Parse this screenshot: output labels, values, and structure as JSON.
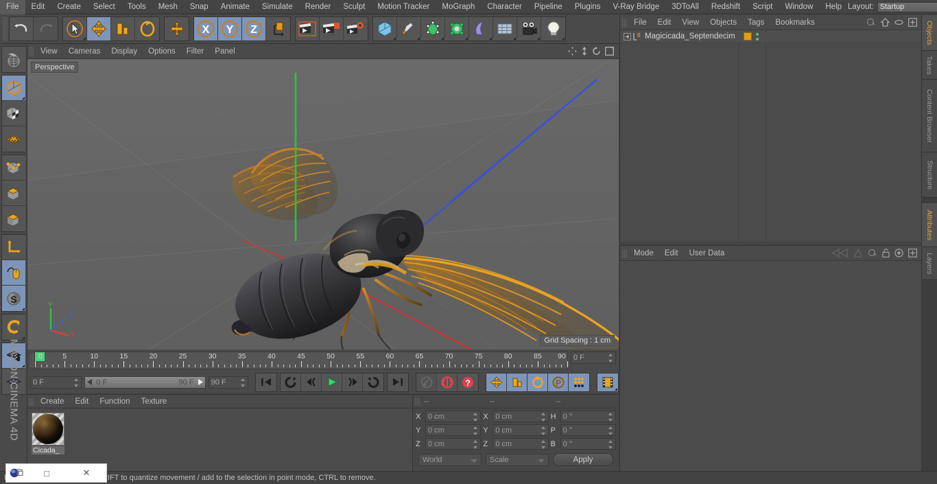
{
  "menubar": {
    "items": [
      "File",
      "Edit",
      "Create",
      "Select",
      "Tools",
      "Mesh",
      "Snap",
      "Animate",
      "Simulate",
      "Render",
      "Sculpt",
      "Motion Tracker",
      "MoGraph",
      "Character",
      "Pipeline",
      "Plugins",
      "V-Ray Bridge",
      "3DToAll",
      "Redshift",
      "Script",
      "Window",
      "Help"
    ],
    "layout_label": "Layout:",
    "layout_value": "Startup"
  },
  "toolbar": {
    "groups": [
      {
        "name": "history",
        "buttons": [
          {
            "name": "undo-button",
            "icon": "undo-icon",
            "state": "normal"
          },
          {
            "name": "redo-button",
            "icon": "redo-icon",
            "state": "disabled"
          }
        ]
      },
      {
        "name": "transform",
        "buttons": [
          {
            "name": "select-tool-button",
            "icon": "cursor-icon",
            "state": "normal"
          },
          {
            "name": "move-tool-button",
            "icon": "move-icon",
            "state": "active"
          },
          {
            "name": "scale-tool-button",
            "icon": "scale-icon",
            "state": "normal"
          },
          {
            "name": "rotate-tool-button",
            "icon": "rotate-icon",
            "state": "normal"
          }
        ]
      },
      {
        "name": "world-axis",
        "buttons": [
          {
            "name": "world-axis-button",
            "icon": "axis-icon",
            "state": "normal"
          }
        ]
      },
      {
        "name": "axis-locks",
        "buttons": [
          {
            "name": "lock-x-button",
            "icon": "x-axis-icon",
            "state": "active"
          },
          {
            "name": "lock-y-button",
            "icon": "y-axis-icon",
            "state": "active"
          },
          {
            "name": "lock-z-button",
            "icon": "z-axis-icon",
            "state": "active"
          },
          {
            "name": "world-coordinate-button",
            "icon": "cube-world-icon",
            "state": "normal"
          }
        ]
      },
      {
        "name": "render",
        "buttons": [
          {
            "name": "render-view-button",
            "icon": "clapper-view-icon",
            "state": "normal"
          },
          {
            "name": "render-to-picture-viewer-button",
            "icon": "clapper-picture-icon",
            "state": "normal"
          },
          {
            "name": "render-settings-button",
            "icon": "clapper-settings-icon",
            "state": "normal"
          }
        ]
      },
      {
        "name": "creation",
        "buttons": [
          {
            "name": "add-cube-button",
            "icon": "cube-icon",
            "state": "normal"
          },
          {
            "name": "add-spline-button",
            "icon": "pen-icon",
            "state": "normal"
          },
          {
            "name": "add-generator-button",
            "icon": "generator-icon",
            "state": "normal"
          },
          {
            "name": "add-deformer-button",
            "icon": "deformer-icon",
            "state": "normal"
          },
          {
            "name": "add-scene-object-button",
            "icon": "environment-icon",
            "state": "normal"
          },
          {
            "name": "add-scene-helper-button",
            "icon": "floor-grid-icon",
            "state": "normal"
          },
          {
            "name": "add-camera-button",
            "icon": "camera-icon",
            "state": "normal"
          },
          {
            "name": "add-light-button",
            "icon": "light-bulb-icon",
            "state": "normal"
          }
        ]
      }
    ]
  },
  "left_toolbar": {
    "buttons": [
      {
        "name": "texture-axis-button",
        "icon": "globe-texture-icon",
        "state": "normal"
      },
      {
        "name": "model-mode-button",
        "icon": "model-cube-icon",
        "state": "active"
      },
      {
        "name": "texture-mode-button",
        "icon": "texture-checker-icon",
        "state": "normal"
      },
      {
        "name": "points-mode-button",
        "icon": "points-grid-icon",
        "state": "normal"
      },
      {
        "name": "edges-mode-button",
        "icon": "edges-cube-icon",
        "state": "normal"
      },
      {
        "name": "polygons-mode-button",
        "icon": "polygon-cube-icon",
        "state": "normal"
      },
      {
        "name": "object-axis-mode-button",
        "icon": "axis-cube-icon",
        "state": "normal"
      },
      {
        "name": "world-object-axis-button",
        "icon": "axis-arrow-icon",
        "state": "normal"
      },
      {
        "name": "enable-axis-button",
        "icon": "mouse-axis-icon",
        "state": "active"
      },
      {
        "name": "soft-selection-button",
        "icon": "s-circle-icon",
        "state": "active"
      },
      {
        "name": "magnet-button",
        "icon": "magnet-icon",
        "state": "normal"
      },
      {
        "name": "viewport-solo-button",
        "icon": "grid-lock-icon",
        "state": "active"
      },
      {
        "name": "workplane-button",
        "icon": "workplane-icon",
        "state": "normal"
      }
    ],
    "brand_line1": "MAXON",
    "brand_line2": "CINEMA 4D"
  },
  "viewport": {
    "menu": [
      "View",
      "Cameras",
      "Display",
      "Options",
      "Filter",
      "Panel"
    ],
    "view_label": "Perspective",
    "grid_spacing": "Grid Spacing : 1 cm",
    "axis": {
      "x": "X",
      "y": "Y",
      "z": "Z",
      "x_color": "#e04040",
      "y_color": "#3ecf52",
      "z_color": "#4060e0"
    },
    "background_color": "#646464",
    "model_name": "Magicicada_Septendecim"
  },
  "timeline": {
    "ticks": [
      0,
      5,
      10,
      15,
      20,
      25,
      30,
      35,
      40,
      45,
      50,
      55,
      60,
      65,
      70,
      75,
      80,
      85,
      90
    ],
    "current_frame_top": "0 F",
    "start_field": "0 F",
    "range_start": "0 F",
    "range_end": "90 F",
    "end_field": "90 F",
    "playback_buttons": [
      {
        "name": "go-to-start-button",
        "icon": "skip-start-icon"
      },
      {
        "name": "previous-keyframe-button",
        "icon": "prev-key-icon"
      },
      {
        "name": "step-back-button",
        "icon": "step-back-icon"
      },
      {
        "name": "play-button",
        "icon": "play-icon"
      },
      {
        "name": "step-forward-button",
        "icon": "step-forward-icon"
      },
      {
        "name": "next-keyframe-button",
        "icon": "next-key-icon"
      },
      {
        "name": "go-to-end-button",
        "icon": "skip-end-icon"
      }
    ],
    "record_buttons": [
      {
        "name": "record-active-objects-button",
        "icon": "key-icon",
        "state": "disabled"
      },
      {
        "name": "autokeying-button",
        "icon": "autokey-icon",
        "state": "normal"
      },
      {
        "name": "keyframe-selection-button",
        "icon": "question-key-icon",
        "state": "normal"
      }
    ],
    "key_toggle_buttons": [
      {
        "name": "position-key-button",
        "icon": "move-key-icon",
        "state": "active"
      },
      {
        "name": "scale-key-button",
        "icon": "scale-key-icon",
        "state": "active"
      },
      {
        "name": "rotation-key-button",
        "icon": "rotate-key-icon",
        "state": "active"
      },
      {
        "name": "parameter-key-button",
        "icon": "param-p-icon",
        "state": "active"
      },
      {
        "name": "point-level-animation-button",
        "icon": "pla-dots-icon",
        "state": "active"
      }
    ],
    "timeline_mode_button": {
      "name": "timeline-mode-button",
      "icon": "film-strip-icon",
      "state": "active"
    }
  },
  "material_manager": {
    "menu": [
      "Create",
      "Edit",
      "Function",
      "Texture"
    ],
    "materials": [
      {
        "name": "Cicada_",
        "label": "Cicada_"
      }
    ]
  },
  "coordinates": {
    "headers": [
      "--",
      "--",
      "--"
    ],
    "position": {
      "label_x": "X",
      "label_y": "Y",
      "label_z": "Z",
      "x": "0 cm",
      "y": "0 cm",
      "z": "0 cm"
    },
    "size": {
      "label_x": "X",
      "label_y": "Y",
      "label_z": "Z",
      "x": "0 cm",
      "y": "0 cm",
      "z": "0 cm"
    },
    "rotation": {
      "label_h": "H",
      "label_p": "P",
      "label_b": "B",
      "h": "0 °",
      "p": "0 °",
      "b": "0 °"
    },
    "system": "World",
    "mode": "Scale",
    "apply_label": "Apply"
  },
  "object_manager": {
    "menu": [
      "File",
      "Edit",
      "View",
      "Objects",
      "Tags",
      "Bookmarks"
    ],
    "objects": [
      {
        "name": "Magicicada_Septendecim",
        "tag_color": "#e0a012",
        "level": 0
      }
    ]
  },
  "attribute_manager": {
    "menu": [
      "Mode",
      "Edit",
      "User Data"
    ]
  },
  "side_tabs_top": [
    "Objects",
    "Takes",
    "Content Browser",
    "Structure"
  ],
  "side_tabs_bottom": [
    "Attributes",
    "Layers"
  ],
  "statusbar": {
    "text": "Move elements. Hold down SHIFT to quantize movement / add to the selection in point mode, CTRL to remove."
  },
  "taskbar_window": {
    "app_icon": "app-orb-icon",
    "restore_label": "❐",
    "maximize_label": "□",
    "close_label": "✕"
  }
}
